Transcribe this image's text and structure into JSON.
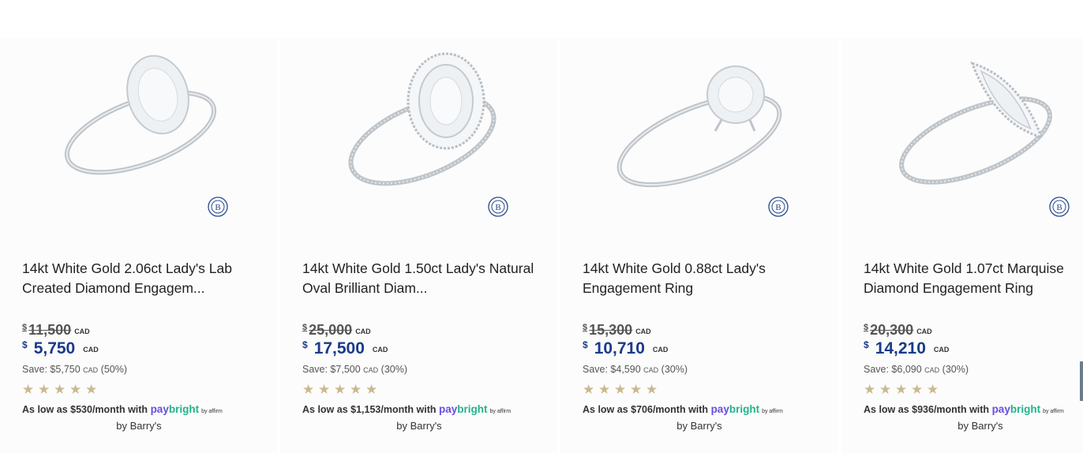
{
  "products": [
    {
      "title": "14kt White Gold 2.06ct Lady's Lab Created Diamond Engagem...",
      "currency_symbol": "$",
      "original_price": "11,500",
      "sale_price": "5,750",
      "currency_code": "CAD",
      "save_text": "Save: $5,750",
      "save_pct": "(50%)",
      "rating": 5,
      "financing_text": "As low as $530/month with",
      "paybright_1": "pay",
      "paybright_2": "bright",
      "affirm_text": "by affirm",
      "seller": "by Barry's",
      "logo_letter": "B"
    },
    {
      "title": "14kt White Gold 1.50ct Lady's Natural Oval Brilliant Diam...",
      "currency_symbol": "$",
      "original_price": "25,000",
      "sale_price": "17,500",
      "currency_code": "CAD",
      "save_text": "Save: $7,500",
      "save_pct": "(30%)",
      "rating": 5,
      "financing_text": "As low as $1,153/month with",
      "paybright_1": "pay",
      "paybright_2": "bright",
      "affirm_text": "by affirm",
      "seller": "by Barry's",
      "logo_letter": "B"
    },
    {
      "title": "14kt White Gold 0.88ct Lady's Engagement Ring",
      "currency_symbol": "$",
      "original_price": "15,300",
      "sale_price": "10,710",
      "currency_code": "CAD",
      "save_text": "Save: $4,590",
      "save_pct": "(30%)",
      "rating": 5,
      "financing_text": "As low as $706/month with",
      "paybright_1": "pay",
      "paybright_2": "bright",
      "affirm_text": "by affirm",
      "seller": "by Barry's",
      "logo_letter": "B"
    },
    {
      "title": "14kt White Gold 1.07ct Marquise Diamond Engagement Ring",
      "currency_symbol": "$",
      "original_price": "20,300",
      "sale_price": "14,210",
      "currency_code": "CAD",
      "save_text": "Save: $6,090",
      "save_pct": "(30%)",
      "rating": 5,
      "financing_text": "As low as $936/month with",
      "paybright_1": "pay",
      "paybright_2": "bright",
      "affirm_text": "by affirm",
      "seller": "by Barry's",
      "logo_letter": "B"
    }
  ],
  "colors": {
    "sale_price": "#1a3a8a",
    "star": "#c9b98f",
    "paybright_pay": "#6a4ce0",
    "paybright_bright": "#22b48c",
    "logo": "#2a4c8c"
  },
  "icons": {
    "rating": "star-icon",
    "brand": "barrys-logo-icon",
    "product_image": "ring-image"
  }
}
